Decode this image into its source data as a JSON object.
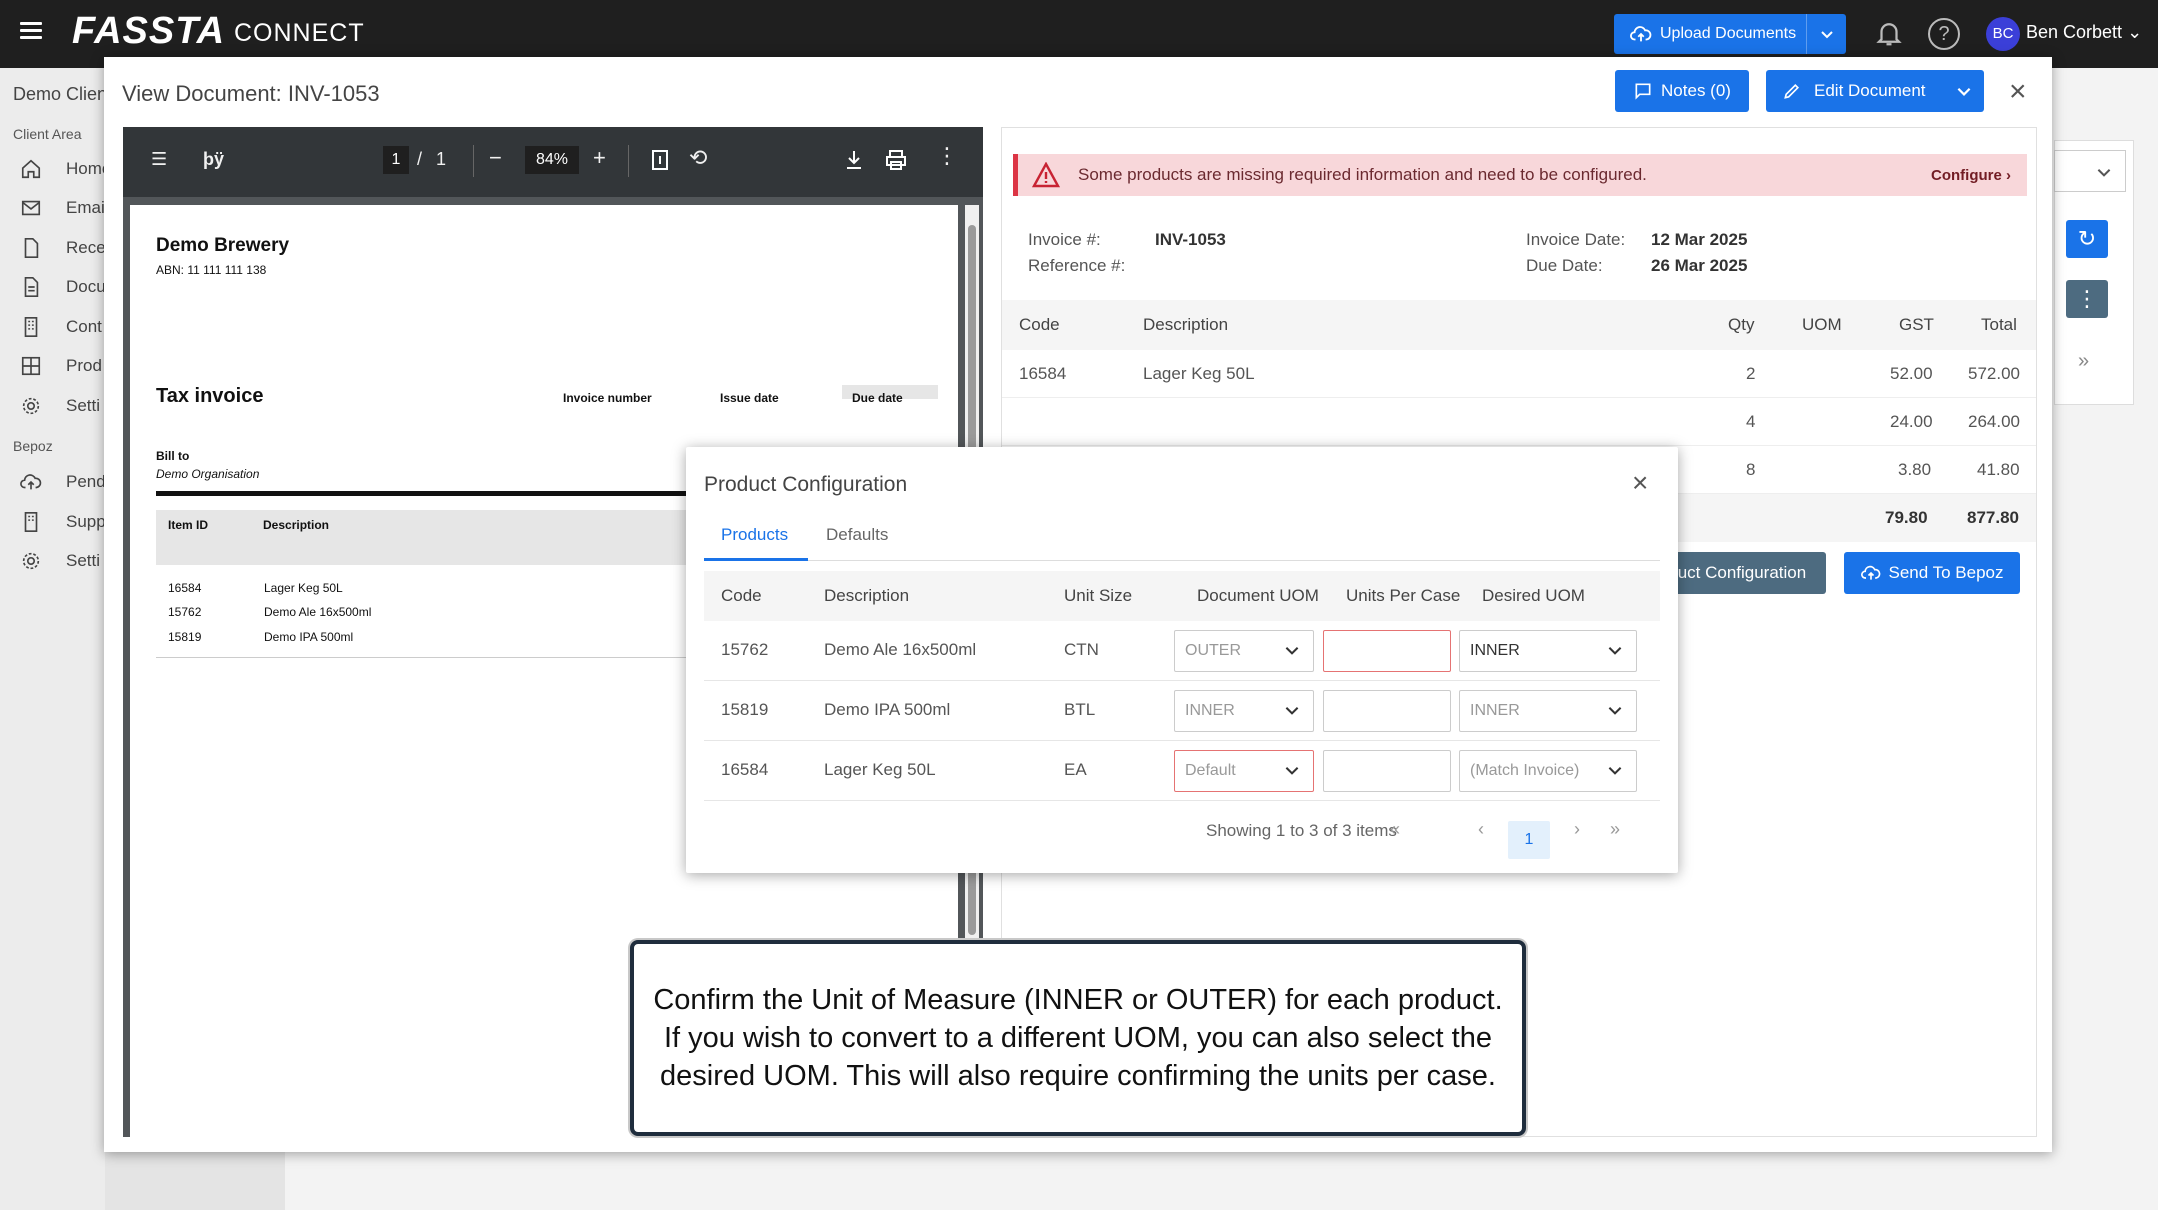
{
  "app": {
    "logo": "FASSTA",
    "logo_suffix": "CONNECT"
  },
  "topbar": {
    "upload_label": "Upload Documents",
    "user_initials": "BC",
    "user_name": "Ben Corbett"
  },
  "sidebar": {
    "client_label": "Demo Client",
    "section_client": "Client Area",
    "section_bepoz": "Bepoz",
    "items": [
      "Home",
      "Email",
      "Rece",
      "Docu",
      "Cont",
      "Prod",
      "Setti"
    ],
    "bepoz_items": [
      "Pend",
      "Supp",
      "Setti"
    ]
  },
  "modal": {
    "title": "View Document: INV-1053",
    "notes_label": "Notes (0)",
    "edit_label": "Edit Document"
  },
  "pdf": {
    "page_current": "1",
    "page_sep": "/",
    "page_total": "1",
    "zoom": "84%",
    "doc_title_glyph": "þÿ",
    "company": "Demo Brewery",
    "abn": "ABN: 11 111 111 138",
    "tax_title": "Tax invoice",
    "invoice_number_label": "Invoice number",
    "issue_date_label": "Issue date",
    "due_date_label": "Due date",
    "bill_to": "Bill to",
    "organisation": "Demo Organisation",
    "col_item": "Item ID",
    "col_desc": "Description",
    "rows": [
      {
        "id": "16584",
        "desc": "Lager Keg 50L"
      },
      {
        "id": "15762",
        "desc": "Demo Ale 16x500ml"
      },
      {
        "id": "15819",
        "desc": "Demo IPA 500ml"
      }
    ]
  },
  "detail": {
    "alert_msg": "Some products are missing required information and need to be configured.",
    "alert_action": "Configure",
    "invoice_label": "Invoice #:",
    "invoice_value": "INV-1053",
    "reference_label": "Reference #:",
    "invoice_date_label": "Invoice Date:",
    "invoice_date_value": "12 Mar 2025",
    "due_date_label": "Due Date:",
    "due_date_value": "26 Mar 2025",
    "cols": {
      "code": "Code",
      "desc": "Description",
      "qty": "Qty",
      "uom": "UOM",
      "gst": "GST",
      "total": "Total"
    },
    "rows": [
      {
        "code": "16584",
        "desc": "Lager Keg 50L",
        "qty": "2",
        "gst": "52.00",
        "total": "572.00"
      },
      {
        "code": "",
        "desc": "",
        "qty": "4",
        "gst": "24.00",
        "total": "264.00"
      },
      {
        "code": "",
        "desc": "",
        "qty": "8",
        "gst": "3.80",
        "total": "41.80"
      }
    ],
    "totals": {
      "gst": "79.80",
      "total": "877.80"
    },
    "product_config_label": "Product Configuration",
    "send_label": "Send To Bepoz"
  },
  "product_config": {
    "title": "Product Configuration",
    "tabs": [
      "Products",
      "Defaults"
    ],
    "cols": {
      "code": "Code",
      "desc": "Description",
      "unit_size": "Unit Size",
      "doc_uom": "Document UOM",
      "units_per_case": "Units Per Case",
      "desired_uom": "Desired UOM"
    },
    "rows": [
      {
        "code": "15762",
        "desc": "Demo Ale 16x500ml",
        "unit_size": "CTN",
        "doc_uom": "OUTER",
        "units_per_case": "",
        "desired_uom": "INNER"
      },
      {
        "code": "15819",
        "desc": "Demo IPA 500ml",
        "unit_size": "BTL",
        "doc_uom": "INNER",
        "units_per_case": "",
        "desired_uom": "INNER"
      },
      {
        "code": "16584",
        "desc": "Lager Keg 50L",
        "unit_size": "EA",
        "doc_uom": "Default",
        "units_per_case": "",
        "desired_uom": "(Match Invoice)"
      }
    ],
    "pager_text": "Showing 1 to 3 of 3 items",
    "current_page": "1"
  },
  "callout": {
    "text": "Confirm the Unit of Measure (INNER or OUTER) for each product. If you wish to convert to a different UOM, you can also select the desired UOM. This will also require confirming the units per case."
  },
  "colors": {
    "primary": "#1a73e8",
    "secondary": "#4d6b80",
    "alert_bg": "#f8d7da",
    "alert_border": "#dc3545",
    "topbar": "#1f1f1f"
  }
}
